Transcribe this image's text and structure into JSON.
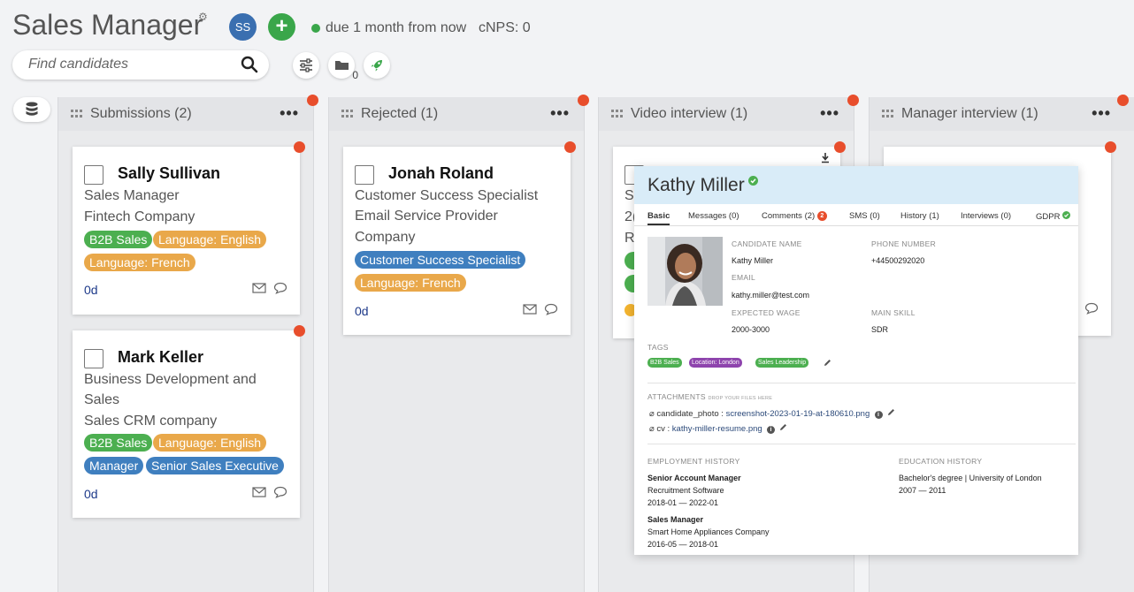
{
  "header": {
    "title": "Sales Manager",
    "avatar_initials": "SS",
    "add_label": "+",
    "due": "due 1 month from now",
    "cnps": "cNPS: 0",
    "folder_count": "0"
  },
  "search": {
    "placeholder": "Find candidates"
  },
  "colors": {
    "accent_blue": "#3a6fb0",
    "green": "#3aa64a",
    "red_dot": "#e84e2c",
    "tag_green": "#4caf50",
    "tag_orange": "#e9a84a",
    "tag_blue": "#3f7fbf",
    "tag_purple": "#8e44ad"
  },
  "columns": [
    {
      "title": "Submissions (2)",
      "menu": "•••",
      "cards": [
        {
          "name": "Sally Sullivan",
          "lines": [
            "Sales Manager",
            "Fintech Company"
          ],
          "tags": [
            "B2B Sales",
            "Language: English",
            "Language: French"
          ],
          "age": "0d"
        },
        {
          "name": "Mark Keller",
          "lines": [
            "Business Development and",
            "Sales",
            "Sales CRM company"
          ],
          "tags": [
            "B2B Sales",
            "Language: English",
            "Manager",
            "Senior Sales Executive"
          ],
          "age": "0d"
        }
      ]
    },
    {
      "title": "Rejected (1)",
      "menu": "•••",
      "cards": [
        {
          "name": "Jonah Roland",
          "lines": [
            "Customer Success Specialist",
            "Email Service Provider",
            "Company"
          ],
          "tags": [
            "Customer Success Specialist",
            "Language: French"
          ],
          "age": "0d"
        }
      ]
    },
    {
      "title": "Video interview (1)",
      "menu": "•••",
      "partial_lines": [
        "S",
        "2(",
        "R"
      ]
    },
    {
      "title": "Manager interview (1)",
      "menu": "•••"
    }
  ],
  "profile": {
    "name": "Kathy Miller",
    "tabs": [
      "Basic",
      "Messages (0)",
      "Comments (2)",
      "SMS (0)",
      "History (1)",
      "Interviews (0)",
      "GDPR"
    ],
    "comments_badge": "2",
    "fields": {
      "candidate_name_label": "CANDIDATE NAME",
      "candidate_name": "Kathy Miller",
      "phone_label": "PHONE NUMBER",
      "phone": "+44500292020",
      "email_label": "EMAIL",
      "email": "kathy.miller@test.com",
      "wage_label": "EXPECTED WAGE",
      "wage": "2000-3000",
      "skill_label": "MAIN SKILL",
      "skill": "SDR"
    },
    "tags_label": "TAGS",
    "tags": [
      "B2B Sales",
      "Location: London",
      "Sales Leadership"
    ],
    "attachments_label": "ATTACHMENTS",
    "attachments_hint": "DROP YOUR FILES HERE",
    "attachments": [
      {
        "key": "candidate_photo :",
        "file": "screenshot-2023-01-19-at-180610.png"
      },
      {
        "key": "cv :",
        "file": "kathy-miller-resume.png"
      }
    ],
    "employment_label": "EMPLOYMENT HISTORY",
    "employment": [
      {
        "title": "Senior Account Manager",
        "company": "Recruitment Software",
        "dates": "2018-01 — 2022-01"
      },
      {
        "title": "Sales Manager",
        "company": "Smart Home Appliances Company",
        "dates": "2016-05 — 2018-01"
      }
    ],
    "education_label": "EDUCATION HISTORY",
    "education": [
      {
        "degree": "Bachelor's degree | University of London",
        "dates": "2007 — 2011"
      }
    ]
  }
}
